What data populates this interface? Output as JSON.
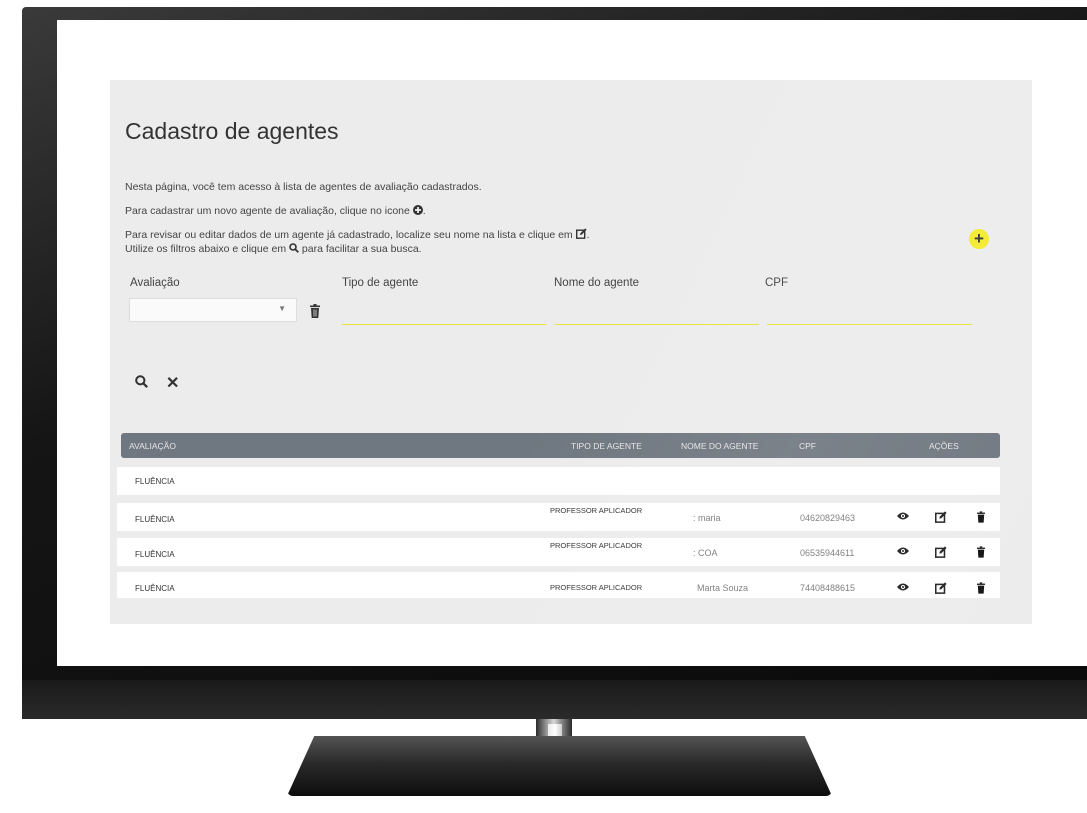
{
  "page": {
    "title": "Cadastro de agentes",
    "intro": {
      "line1": "Nesta página, você tem acesso à lista de agentes de avaliação cadastrados.",
      "line2_before": "Para cadastrar um novo agente de avaliação, clique no icone",
      "line2_after": ".",
      "line3_before": "Para revisar ou editar dados de um agente já cadastrado, localize seu nome na lista e clique em",
      "line3_after": ".",
      "line4_before": "Utilize os filtros abaixo e clique em",
      "line4_after": "para facilitar a sua busca."
    },
    "add_button_label": "+"
  },
  "filters": {
    "avaliacao_label": "Avaliação",
    "avaliacao_value": "",
    "tipo_label": "Tipo de agente",
    "nome_label": "Nome do agente",
    "cpf_label": "CPF"
  },
  "table": {
    "headers": [
      "AVALIAÇÃO",
      "TIPO DE AGENTE",
      "NOME DO AGENTE",
      "CPF",
      "AÇÕES"
    ],
    "rows": [
      {
        "avaliacao": "FLUÊNCIA",
        "tipo": "",
        "nome": "",
        "cpf": ""
      },
      {
        "avaliacao": "FLUÊNCIA",
        "tipo": "PROFESSOR APLICADOR",
        "nome": ": maria",
        "cpf": "04620829463"
      },
      {
        "avaliacao": "FLUÊNCIA",
        "tipo": "PROFESSOR APLICADOR",
        "nome": ": COA",
        "cpf": "06535944611"
      },
      {
        "avaliacao": "FLUÊNCIA",
        "tipo": "PROFESSOR APLICADOR",
        "nome": "Marta Souza",
        "cpf": "74408488615"
      }
    ]
  },
  "icons": {
    "add": "plus-circle-icon",
    "edit": "edit-icon",
    "search": "search-icon",
    "clear": "close-icon",
    "delete": "trash-icon",
    "view": "eye-icon"
  },
  "colors": {
    "accent_yellow": "#f3ea2a",
    "header_gray": "#6f7780",
    "panel_bg": "#ececec",
    "text": "#333333"
  }
}
